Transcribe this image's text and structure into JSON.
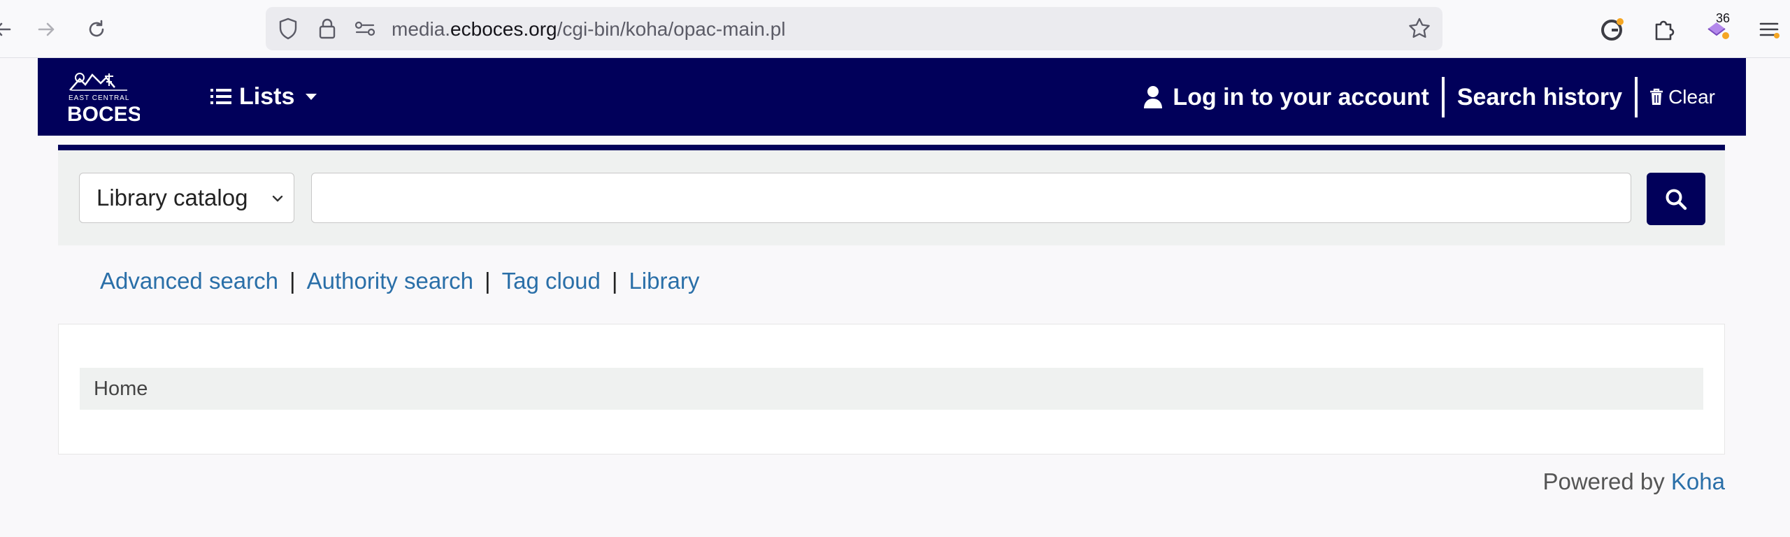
{
  "browser": {
    "url_prefix": "media.",
    "url_domain": "ecboces.org",
    "url_path": "/cgi-bin/koha/opac-main.pl",
    "extensions_badge": "36"
  },
  "header": {
    "logo_text_top": "EAST CENTRAL",
    "logo_text_main": "BOCES",
    "lists_label": "Lists",
    "login_label": "Log in to your account",
    "search_history_label": "Search history",
    "clear_label": "Clear"
  },
  "search": {
    "catalog_selected": "Library catalog",
    "query_value": ""
  },
  "links": {
    "advanced": "Advanced search",
    "authority": "Authority search",
    "tag_cloud": "Tag cloud",
    "library": "Library",
    "separator": "|"
  },
  "breadcrumb": {
    "home": "Home"
  },
  "footer": {
    "powered_by": "Powered by",
    "koha": "Koha"
  },
  "colors": {
    "header_bg": "#01005a",
    "link": "#2a6fa8",
    "band_bg": "#eff1f0"
  }
}
